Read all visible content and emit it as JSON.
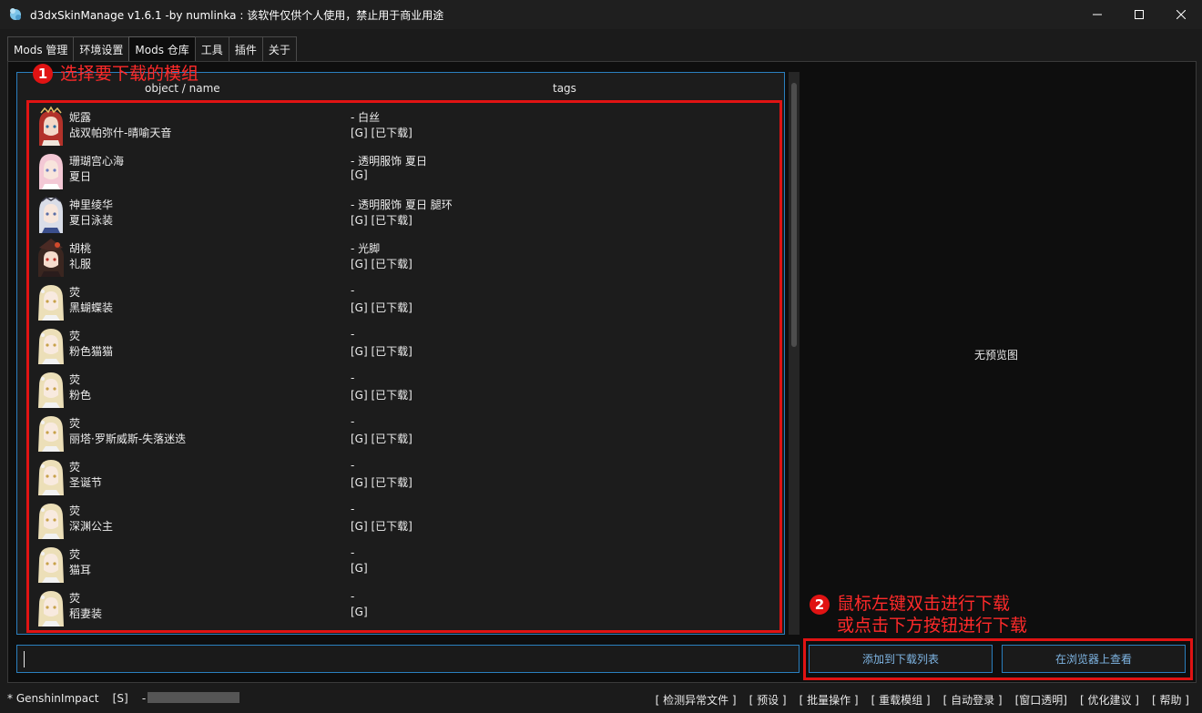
{
  "window": {
    "title": "d3dxSkinManage v1.6.1 -by numlinka : 该软件仅供个人使用，禁止用于商业用途",
    "minimize_icon": "minimize-icon",
    "maximize_icon": "maximize-icon",
    "close_icon": "close-icon"
  },
  "tabs": [
    {
      "label": "Mods 管理",
      "active": false
    },
    {
      "label": "环境设置",
      "active": false
    },
    {
      "label": "Mods 仓库",
      "active": true
    },
    {
      "label": "工具",
      "active": false
    },
    {
      "label": "插件",
      "active": false
    },
    {
      "label": "关于",
      "active": false
    }
  ],
  "list": {
    "columns": {
      "name": "object / name",
      "tags": "tags"
    },
    "rows": [
      {
        "object": "妮露",
        "name": "战双帕弥什-晴喻天音",
        "tags": "- 白丝",
        "status": "[G] [已下载]",
        "avatar": "nilou"
      },
      {
        "object": "珊瑚宫心海",
        "name": "夏日",
        "tags": "- 透明服饰 夏日",
        "status": "[G]",
        "avatar": "kokomi"
      },
      {
        "object": "神里绫华",
        "name": "夏日泳装",
        "tags": "- 透明服饰 夏日 腿环",
        "status": "[G] [已下载]",
        "avatar": "ayaka"
      },
      {
        "object": "胡桃",
        "name": "礼服",
        "tags": "- 光脚",
        "status": "[G] [已下载]",
        "avatar": "hutao"
      },
      {
        "object": "荧",
        "name": "黑蝴蝶装",
        "tags": "-",
        "status": "[G] [已下载]",
        "avatar": "lumine"
      },
      {
        "object": "荧",
        "name": "粉色猫猫",
        "tags": "-",
        "status": "[G] [已下载]",
        "avatar": "lumine"
      },
      {
        "object": "荧",
        "name": "粉色",
        "tags": "-",
        "status": "[G] [已下载]",
        "avatar": "lumine"
      },
      {
        "object": "荧",
        "name": "丽塔·罗斯威斯-失落迷迭",
        "tags": "-",
        "status": "[G] [已下载]",
        "avatar": "lumine"
      },
      {
        "object": "荧",
        "name": "圣诞节",
        "tags": "-",
        "status": "[G] [已下载]",
        "avatar": "lumine"
      },
      {
        "object": "荧",
        "name": "深渊公主",
        "tags": "-",
        "status": "[G] [已下载]",
        "avatar": "lumine"
      },
      {
        "object": "荧",
        "name": "猫耳",
        "tags": "-",
        "status": "[G]",
        "avatar": "lumine"
      },
      {
        "object": "荧",
        "name": "稻妻装",
        "tags": "-",
        "status": "[G]",
        "avatar": "lumine"
      }
    ]
  },
  "preview": {
    "empty_text": "无预览图"
  },
  "search": {
    "value": ""
  },
  "buttons": {
    "add_to_download": "添加到下载列表",
    "view_in_browser": "在浏览器上查看"
  },
  "annotations": {
    "step1_number": "1",
    "step1_text": "选择要下载的模组",
    "step2_number": "2",
    "step2_line1": "鼠标左键双击进行下载",
    "step2_line2": "或点击下方按钮进行下载",
    "color": "#e01313"
  },
  "status": {
    "game": "* GenshinImpact",
    "mode": "[S]",
    "separator": "-",
    "links": [
      "[ 检测异常文件 ]",
      "[ 预设 ]",
      "[ 批量操作 ]",
      "[ 重载模组 ]",
      "[ 自动登录 ]",
      "[窗口透明]",
      "[ 优化建议 ]",
      "[ 帮助 ]"
    ]
  },
  "colors": {
    "accent": "#2a7fbf",
    "annotation": "#e01313",
    "background": "#0e0e0e"
  }
}
